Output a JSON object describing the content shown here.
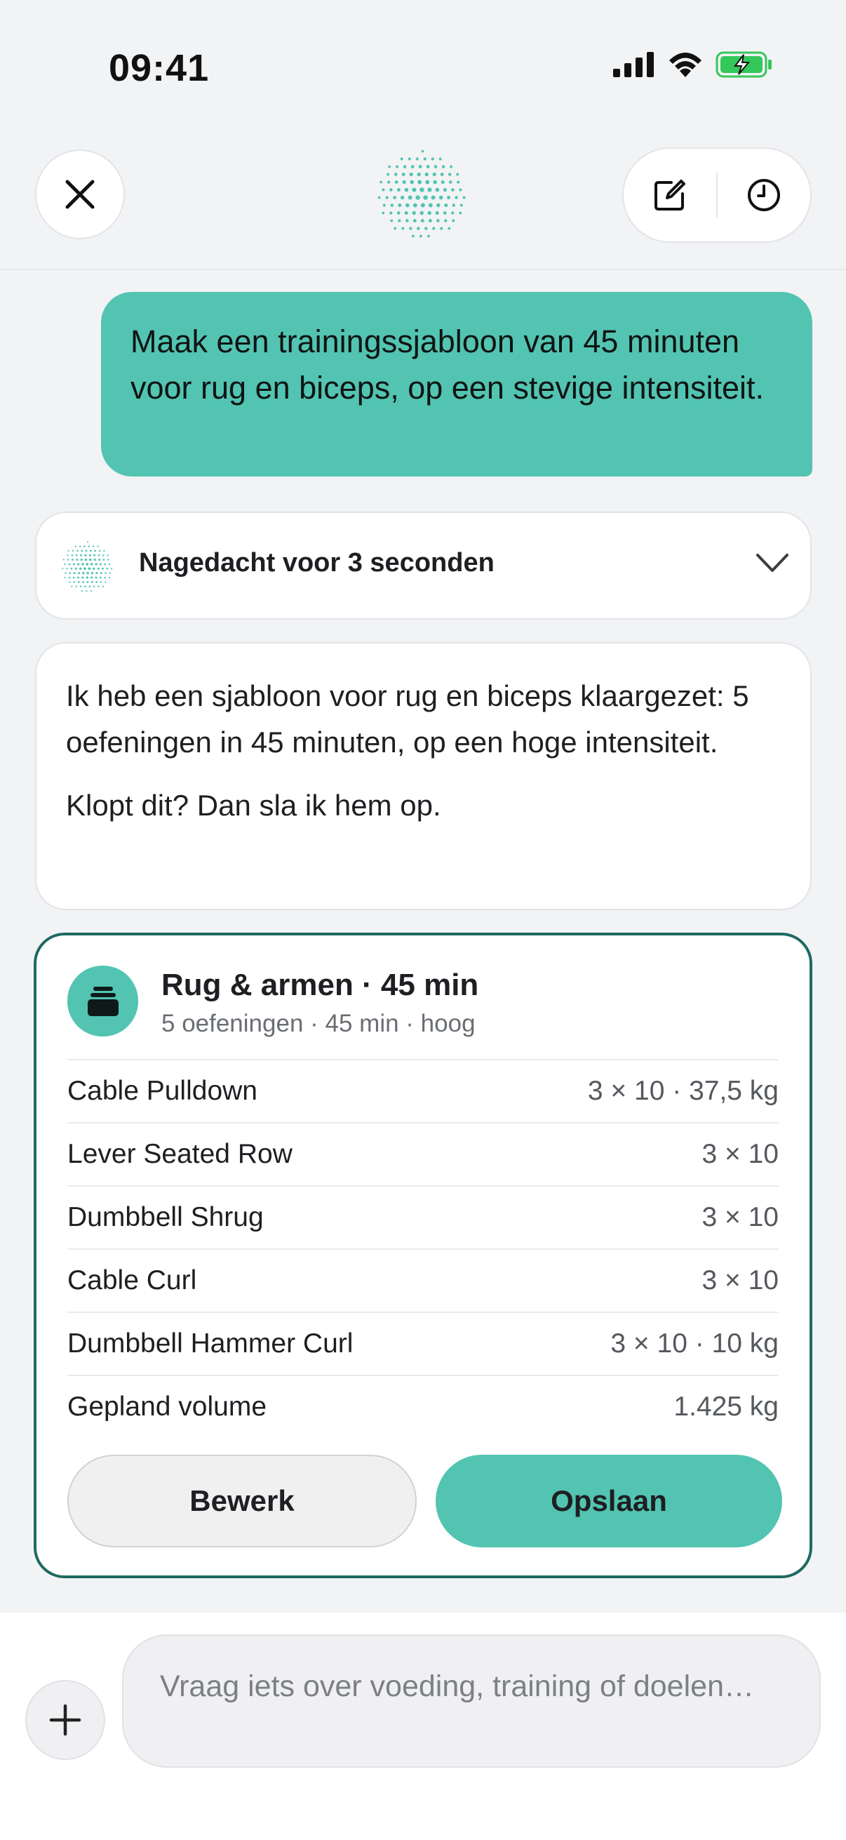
{
  "status_bar": {
    "time": "09:41",
    "icons": [
      "signal-icon",
      "wifi-icon",
      "battery-charging-icon"
    ],
    "battery_color": "#34c759"
  },
  "header": {
    "close_icon": "close-icon",
    "new_chat_icon": "compose-icon",
    "history_icon": "clock-icon",
    "logo_icon": "dotted-sphere-logo"
  },
  "colors": {
    "accent": "#52c4b1",
    "card_border": "#1e6a62",
    "background": "#f2f3f5"
  },
  "chat": {
    "user_message": "Maak een trainingssjabloon van 45 minuten voor rug en biceps, op een stevige intensiteit.",
    "thinking_label": "Nagedacht voor 3 seconden",
    "assistant_paragraph_1": "Ik heb een sjabloon voor rug en biceps klaargezet: 5 oefeningen in 45 minuten, op een hoge intensiteit.",
    "assistant_paragraph_2": "Klopt dit? Dan sla ik hem op."
  },
  "template": {
    "icon": "weight-plate-icon",
    "title": "Rug & armen · 45 min",
    "subtitle": "5 oefeningen · 45 min · hoog",
    "rows": [
      {
        "name": "Cable Pulldown",
        "value": "3 × 10 · 37,5 kg"
      },
      {
        "name": "Lever Seated Row",
        "value": "3 × 10"
      },
      {
        "name": "Dumbbell Shrug",
        "value": "3 × 10"
      },
      {
        "name": "Cable Curl",
        "value": "3 × 10"
      },
      {
        "name": "Dumbbell Hammer Curl",
        "value": "3 × 10 · 10 kg"
      },
      {
        "name": "Gepland volume",
        "value": "1.425 kg"
      }
    ],
    "edit_label": "Bewerk",
    "save_label": "Opslaan"
  },
  "composer": {
    "placeholder": "Vraag iets over voeding, training of doelen…",
    "plus_icon": "plus-icon"
  }
}
